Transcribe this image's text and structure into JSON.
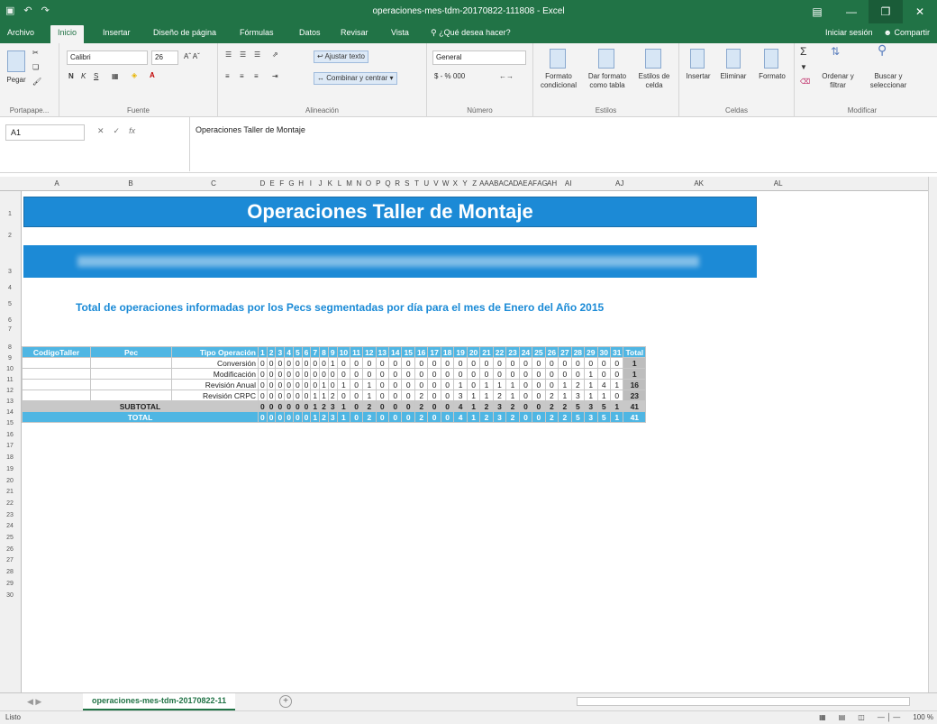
{
  "app": {
    "title": "operaciones-mes-tdm-20170822-111808 - Excel"
  },
  "tabs": [
    "Archivo",
    "Inicio",
    "Insertar",
    "Diseño de página",
    "Fórmulas",
    "Datos",
    "Revisar",
    "Vista"
  ],
  "tell_me": "¿Qué desea hacer?",
  "account": {
    "signin": "Iniciar sesión",
    "share": "Compartir"
  },
  "ribbon": {
    "paste": "Pegar",
    "clipboard": "Portapape...",
    "font_name": "Calibri",
    "font_size": "26",
    "font_group": "Fuente",
    "bold": "N",
    "italic": "K",
    "underline": "S",
    "wrap": "Ajustar texto",
    "merge": "Combinar y centrar",
    "align_group": "Alineación",
    "number_format": "General",
    "num_symbols": "$ - % 000",
    "number_group": "Número",
    "cond_format": "Formato condicional",
    "format_table": "Dar formato como tabla",
    "cell_styles": "Estilos de celda",
    "styles_group": "Estilos",
    "insert": "Insertar",
    "delete": "Eliminar",
    "format": "Formato",
    "cells_group": "Celdas",
    "sort": "Ordenar y filtrar",
    "find": "Buscar y seleccionar",
    "edit_group": "Modificar"
  },
  "formula": {
    "name_box": "A1",
    "fx": "fx",
    "content": "Operaciones Taller de Montaje"
  },
  "columns": [
    "A",
    "B",
    "C",
    "D",
    "E",
    "F",
    "G",
    "H",
    "I",
    "J",
    "K",
    "L",
    "M",
    "N",
    "O",
    "P",
    "Q",
    "R",
    "S",
    "T",
    "U",
    "V",
    "W",
    "X",
    "Y",
    "Z",
    "AA",
    "AB",
    "AC",
    "AD",
    "AE",
    "AF",
    "AG",
    "AH",
    "AI",
    "AJ",
    "AK",
    "AL"
  ],
  "sheet": {
    "title": "Operaciones Taller de Montaje",
    "subtitle": "Total de operaciones informadas por los Pecs segmentadas por día para el mes de Enero del Año 2015",
    "headers": [
      "CodigoTaller",
      "Pec",
      "Tipo Operación",
      "1",
      "2",
      "3",
      "4",
      "5",
      "6",
      "7",
      "8",
      "9",
      "10",
      "11",
      "12",
      "13",
      "14",
      "15",
      "16",
      "17",
      "18",
      "19",
      "20",
      "21",
      "22",
      "23",
      "24",
      "25",
      "26",
      "27",
      "28",
      "29",
      "30",
      "31",
      "Total"
    ],
    "rows": [
      {
        "type": "Conversión",
        "days": [
          "0",
          "0",
          "0",
          "0",
          "0",
          "0",
          "0",
          "0",
          "1",
          "0",
          "0",
          "0",
          "0",
          "0",
          "0",
          "0",
          "0",
          "0",
          "0",
          "0",
          "0",
          "0",
          "0",
          "0",
          "0",
          "0",
          "0",
          "0",
          "0",
          "0",
          "0"
        ],
        "total": "1"
      },
      {
        "type": "Modificación",
        "days": [
          "0",
          "0",
          "0",
          "0",
          "0",
          "0",
          "0",
          "0",
          "0",
          "0",
          "0",
          "0",
          "0",
          "0",
          "0",
          "0",
          "0",
          "0",
          "0",
          "0",
          "0",
          "0",
          "0",
          "0",
          "0",
          "0",
          "0",
          "0",
          "1",
          "0",
          "0"
        ],
        "total": "1"
      },
      {
        "type": "Revisión Anual",
        "days": [
          "0",
          "0",
          "0",
          "0",
          "0",
          "0",
          "0",
          "1",
          "0",
          "1",
          "0",
          "1",
          "0",
          "0",
          "0",
          "0",
          "0",
          "0",
          "1",
          "0",
          "1",
          "1",
          "1",
          "0",
          "0",
          "0",
          "1",
          "2",
          "1",
          "4",
          "1"
        ],
        "total": "16"
      },
      {
        "type": "Revisión CRPC",
        "days": [
          "0",
          "0",
          "0",
          "0",
          "0",
          "0",
          "1",
          "1",
          "2",
          "0",
          "0",
          "1",
          "0",
          "0",
          "0",
          "2",
          "0",
          "0",
          "3",
          "1",
          "1",
          "2",
          "1",
          "0",
          "0",
          "2",
          "1",
          "3",
          "1",
          "1",
          "0"
        ],
        "total": "23"
      }
    ],
    "subtotal": {
      "label": "SUBTOTAL",
      "days": [
        "0",
        "0",
        "0",
        "0",
        "0",
        "0",
        "1",
        "2",
        "3",
        "1",
        "0",
        "2",
        "0",
        "0",
        "0",
        "2",
        "0",
        "0",
        "4",
        "1",
        "2",
        "3",
        "2",
        "0",
        "0",
        "2",
        "2",
        "5",
        "3",
        "5",
        "1"
      ],
      "total": "41"
    },
    "grand_total": {
      "label": "TOTAL",
      "days": [
        "0",
        "0",
        "0",
        "0",
        "0",
        "0",
        "1",
        "2",
        "3",
        "1",
        "0",
        "2",
        "0",
        "0",
        "0",
        "2",
        "0",
        "0",
        "4",
        "1",
        "2",
        "3",
        "2",
        "0",
        "0",
        "2",
        "2",
        "5",
        "3",
        "5",
        "1"
      ],
      "total": "41"
    }
  },
  "sheet_tab": "operaciones-mes-tdm-20170822-11",
  "status": {
    "ready": "Listo",
    "zoom": "100 %"
  },
  "colors": {
    "excel_green": "#217346",
    "title_blue": "#1c8ad6",
    "header_blue": "#4fb6e3"
  }
}
